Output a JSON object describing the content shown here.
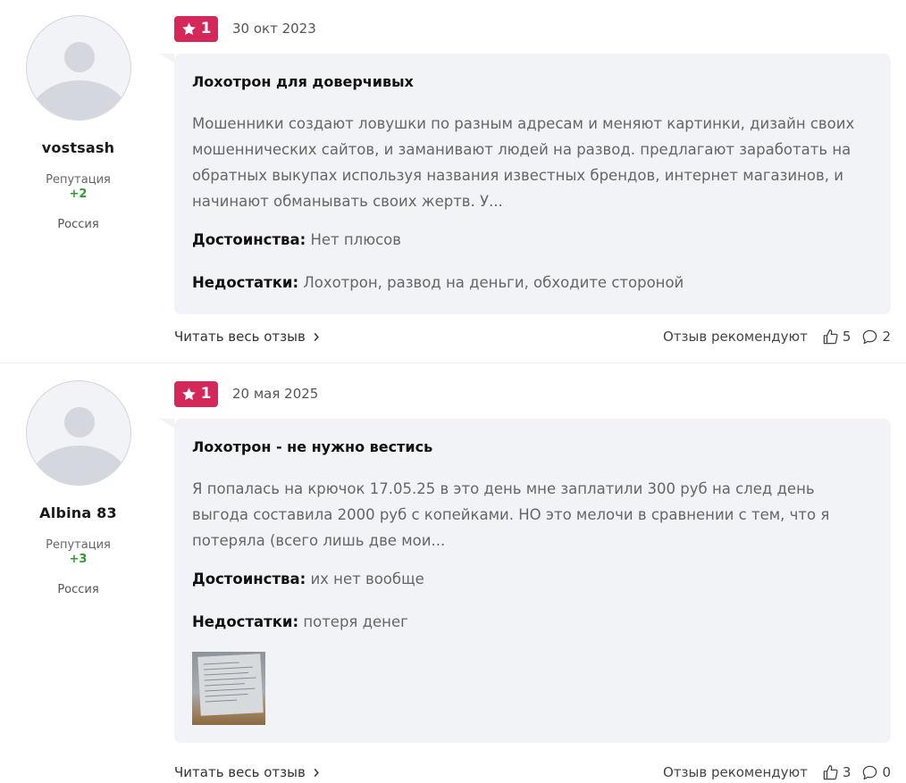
{
  "reviews": [
    {
      "author": "vostsash",
      "reputation_label": "Репутация",
      "reputation": "+2",
      "country": "Россия",
      "rating": "1",
      "date": "30 окт 2023",
      "title": "Лохотрон для доверчивых",
      "text": "Мошенники создают ловушки по разным адресам и меняют картинки, дизайн своих мошеннических сайтов, и заманивают людей на развод. предлагают заработать на обратных выкупах используя названия известных брендов, интернет магазинов, и начинают обманывать своих жертв. У...",
      "pros_label": "Достоинства:",
      "pros": "Нет плюсов",
      "cons_label": "Недостатки:",
      "cons": "Лохотрон, развод на деньги, обходите стороной",
      "read_more": "Читать весь отзыв",
      "recommend_label": "Отзыв рекомендуют",
      "likes": "5",
      "comments": "2"
    },
    {
      "author": "Albina 83",
      "reputation_label": "Репутация",
      "reputation": "+3",
      "country": "Россия",
      "rating": "1",
      "date": "20 мая 2025",
      "title": "Лохотрон - не нужно вестись",
      "text": "Я попалась на крючок 17.05.25 в это день мне заплатили 300 руб на след день выгода составила 2000 руб с копейками. НО это мелочи в сравнении с тем, что я потеряла (всего лишь две мои...",
      "pros_label": "Достоинства:",
      "pros": "их нет вообще",
      "cons_label": "Недостатки:",
      "cons": "потеря денег",
      "read_more": "Читать весь отзыв",
      "recommend_label": "Отзыв рекомендуют",
      "likes": "3",
      "comments": "0"
    }
  ],
  "colors": {
    "badge": "#d6275b",
    "reputation": "#2e9e2e",
    "card_bg": "#f2f3f6"
  },
  "icons": {
    "rating": "star-icon",
    "read_more": "chevron-right-icon",
    "likes": "thumbs-up-icon",
    "comments": "comment-bubble-icon",
    "avatar": "default-user-avatar"
  }
}
